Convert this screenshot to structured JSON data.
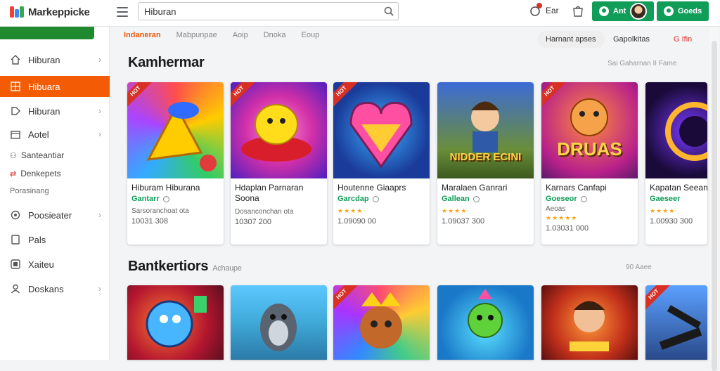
{
  "header": {
    "logo": "Markeppicke",
    "search_value": "Hiburan",
    "cart_label": "Ear",
    "button1_label": "Ant",
    "button2_label": "Goeds"
  },
  "sidebar": {
    "items": [
      {
        "label": "Hiburan",
        "icon": "home-icon"
      },
      {
        "label": "Hibuara",
        "icon": "grid-icon"
      },
      {
        "label": "Hiburan",
        "icon": "tag-icon"
      },
      {
        "label": "Aotel",
        "icon": "calendar-icon"
      }
    ],
    "subs": [
      {
        "label": "Santeantiar",
        "icon": "people-icon"
      },
      {
        "label": "Denkepets",
        "icon": "shuffle-icon"
      },
      {
        "label": "Porasinang"
      }
    ],
    "items2": [
      {
        "label": "Poosieater",
        "icon": "settings-icon"
      },
      {
        "label": "Pals",
        "icon": "tablet-icon"
      },
      {
        "label": "Xaiteu",
        "icon": "square-icon"
      },
      {
        "label": "Doskans",
        "icon": "person-icon"
      }
    ]
  },
  "filters": {
    "tabs": [
      "Indaneran",
      "Mabpunpae",
      "Aoip",
      "Dnoka",
      "Eoup"
    ],
    "pills": [
      "Harnant apses",
      "Gapolkitas",
      "G Ifin"
    ]
  },
  "section1": {
    "title": "Kamhermar",
    "link": "Sai Gaharnan II Fame",
    "cards": [
      {
        "title": "Hiburam Hiburana",
        "studio": "Gantarr",
        "desc": "Sarsoranchoat ota",
        "price": "10031 308"
      },
      {
        "title": "Hdaplan Parnaran Soona",
        "studio": "",
        "desc": "Dosanconchan ota",
        "price": "10307 200"
      },
      {
        "title": "Houtenne Giaaprs",
        "studio": "Garcdap",
        "desc": "",
        "stars": "★★★★",
        "price": "1.09090 00"
      },
      {
        "title": "Maralaen Ganrari",
        "studio": "Gallean",
        "desc": "",
        "stars": "★★★★",
        "price": "1.09037 300"
      },
      {
        "title": "Karnars Canfapi",
        "studio": "Goeseor",
        "desc": "Aeoas",
        "stars": "★★★★★",
        "price": "1.03031 000"
      },
      {
        "title": "Kapatan Seean",
        "studio": "Gaeseer",
        "desc": "",
        "stars": "★★★★",
        "price": "1.00930 300"
      }
    ],
    "thumb_labels": [
      "NIDDER ECINI",
      "DRUAS"
    ]
  },
  "section2": {
    "title": "Bantkertiors",
    "subtitle": "Achaupe",
    "link": "90 Aaee"
  },
  "colors": {
    "accent_orange": "#f35b04",
    "brand_green": "#0f9d58",
    "badge_red": "#d93025"
  }
}
